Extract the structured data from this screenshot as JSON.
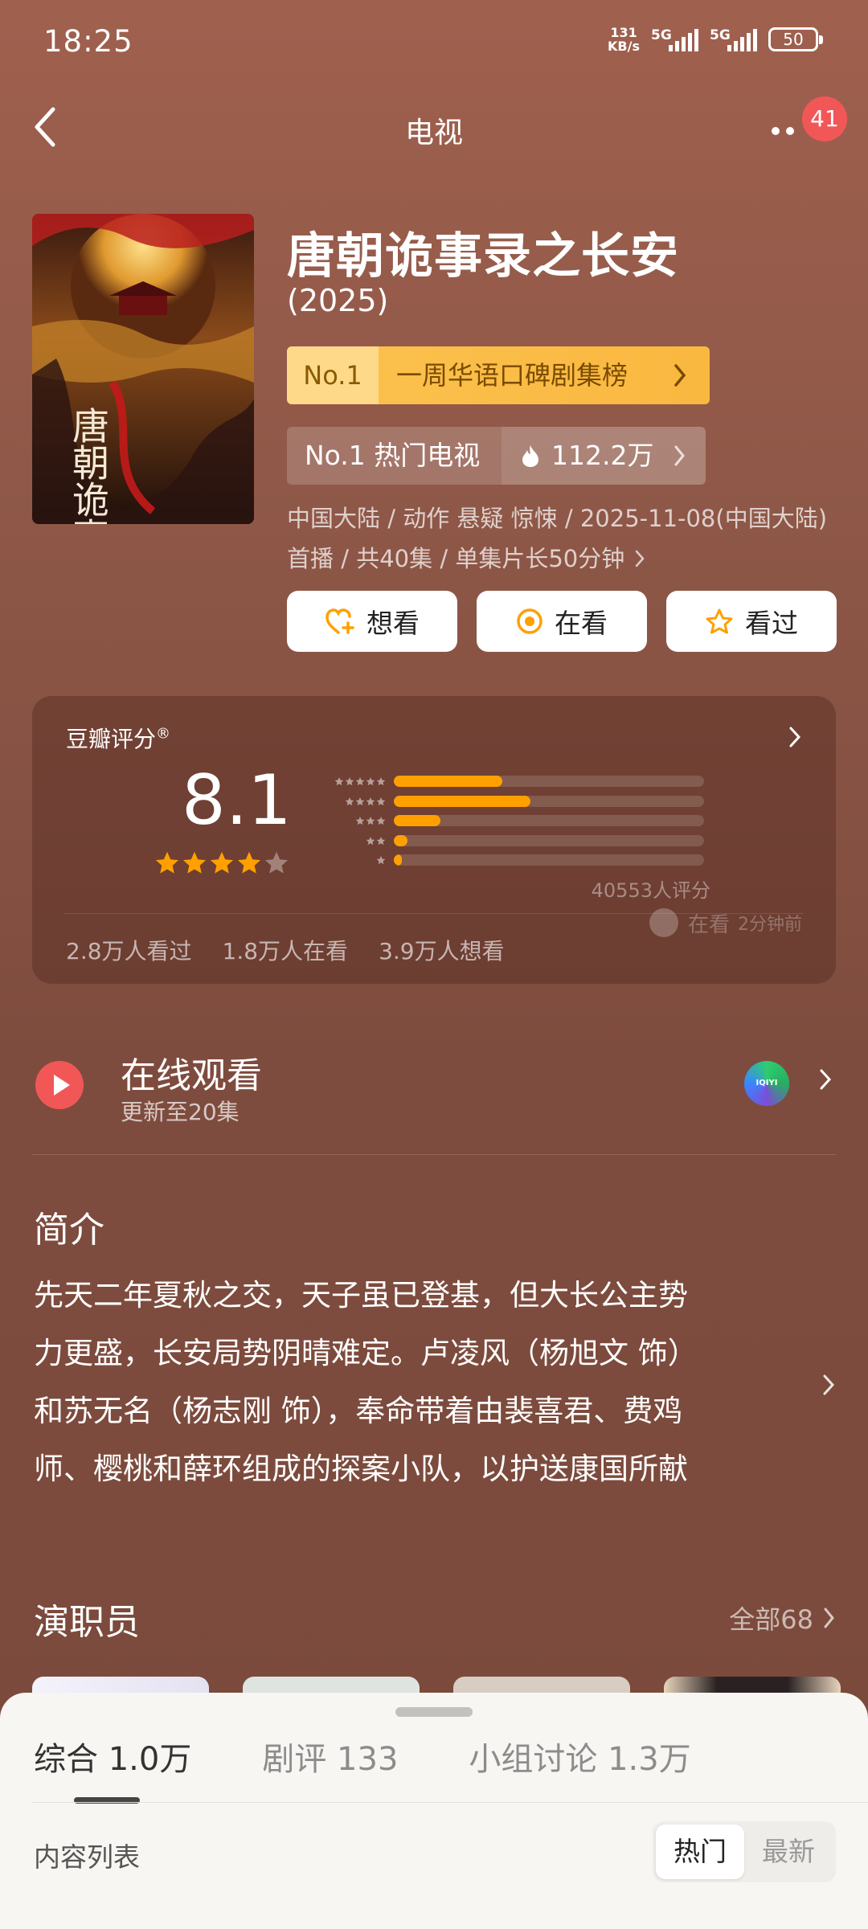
{
  "status_bar": {
    "time": "18:25",
    "net_speed_value": "131",
    "net_speed_unit": "KB/s",
    "signal1": "5G",
    "signal2": "5G",
    "battery": "50"
  },
  "nav": {
    "title": "电视",
    "notification_count": "41"
  },
  "movie": {
    "title": "唐朝诡事录之长安",
    "year": "(2025)",
    "rank_weekly": {
      "no": "No.1",
      "label": "一周华语口碑剧集榜"
    },
    "rank_hot": {
      "label": "No.1 热门电视",
      "heat": "112.2万"
    },
    "meta_line1": "中国大陆 / 动作 悬疑 惊悚 / 2025-11-08(中国大陆)",
    "meta_line2": "首播 / 共40集 / 单集片长50分钟",
    "poster_text": "唐朝诡事录"
  },
  "actions": {
    "want": "想看",
    "watching": "在看",
    "watched": "看过"
  },
  "rating": {
    "label": "豆瓣评分",
    "mark": "®",
    "score": "8.1",
    "star_value": 4,
    "distribution": [
      0.35,
      0.44,
      0.15,
      0.045,
      0.025
    ],
    "count": "40553人评分",
    "watching_faded": "在看",
    "watching_faded_time": "2分钟前",
    "stats": [
      "2.8万人看过",
      "1.8万人在看",
      "3.9万人想看"
    ]
  },
  "online": {
    "title": "在线观看",
    "subtitle": "更新至20集",
    "platform": "IQIYI"
  },
  "intro": {
    "title": "简介",
    "lines": [
      "先天二年夏秋之交，天子虽已登基，但大长公主势",
      "力更盛，长安局势阴晴难定。卢凌风（杨旭文 饰）",
      "和苏无名（杨志刚 饰），奉命带着由裴喜君、费鸡",
      "师、樱桃和薛环组成的探案小队，以护送康国所献"
    ]
  },
  "cast": {
    "title": "演职员",
    "all_label": "全部68"
  },
  "sheet": {
    "tabs": [
      "综合 1.0万",
      "剧评 133",
      "小组讨论 1.3万"
    ],
    "content_list": "内容列表",
    "sort_hot": "热门",
    "sort_new": "最新"
  },
  "colors": {
    "accent_orange": "#ffa000",
    "play_red": "#f25757",
    "rank_gold": "#fbc04c"
  }
}
